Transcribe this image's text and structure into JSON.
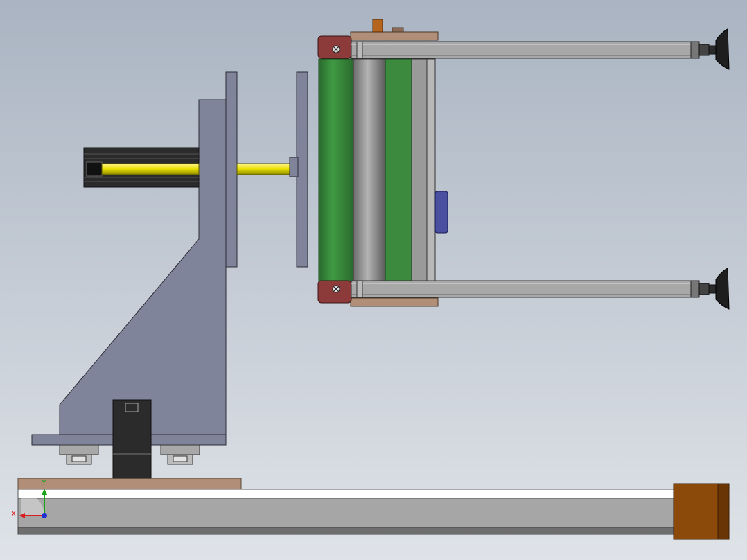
{
  "viewport": {
    "background_top": "#aab4c2",
    "background_bottom": "#dfe3e8"
  },
  "triad": {
    "x_label": "X",
    "y_label": "Y",
    "x_color": "#d81e1e",
    "y_color": "#19a319",
    "z_color": "#1e2fd8"
  },
  "colors": {
    "steel": "#80849a",
    "steel_dark": "#4a4d5a",
    "rail": "#a6a6a6",
    "rail_dark": "#6e6e6e",
    "motor": "#8b4a0a",
    "motor_dark": "#6a3505",
    "belt_green": "#3b8a3e",
    "roller_grey": "#8c8c8c",
    "yellow_rod": "#e8e000",
    "black_part": "#2b2b2b",
    "clamp_red": "#8c3a3a",
    "wood": "#b08e78",
    "blue_box": "#4a4fa0"
  },
  "parts": [
    "linear-rail-base",
    "stepper-motor-block",
    "carriage-plate",
    "support-bracket",
    "guide-blocks",
    "motor-mount",
    "pneumatic-cylinder",
    "piston-rod",
    "flange-plates",
    "belt-conveyor",
    "side-rods",
    "leveling-feet"
  ]
}
